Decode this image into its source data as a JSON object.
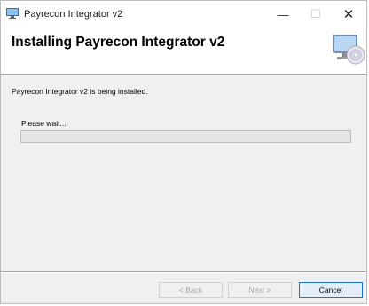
{
  "window": {
    "title": "Payrecon Integrator v2",
    "minimize": "—",
    "maximize": "☐",
    "close": "✕"
  },
  "header": {
    "heading": "Installing Payrecon Integrator v2"
  },
  "body": {
    "status_text": "Payrecon Integrator v2 is being installed.",
    "wait_text": "Please wait...",
    "progress_fraction": 0
  },
  "buttons": {
    "back_label": "< Back",
    "next_label": "Next >",
    "cancel_label": "Cancel"
  },
  "colors": {
    "accent": "#1e72d7",
    "progress_fill": "#06b025",
    "disabled_text": "#a5a5a5"
  },
  "icons": {
    "app": "installer-app-icon",
    "header": "computer-cd-icon"
  }
}
